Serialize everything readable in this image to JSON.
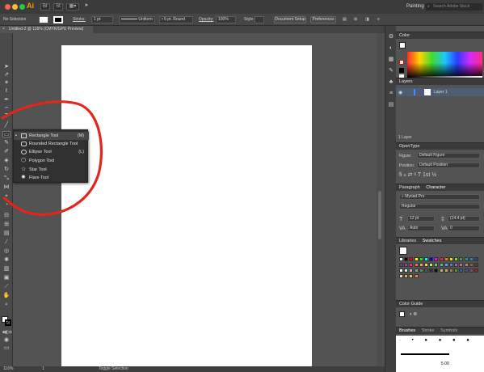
{
  "menubar": {
    "workspace": "Painting",
    "search_placeholder": "Search Adobe Stock",
    "traffic_colors": [
      "#fe5f57",
      "#febb2e",
      "#28c840"
    ],
    "app_icon": "Ai"
  },
  "controlbar": {
    "selection": "No Selection",
    "stroke_label": "Stroke:",
    "stroke_weight": "1 pt",
    "profile": "Uniform",
    "brush": "5 pt. Round",
    "opacity_label": "Opacity:",
    "opacity_value": "100%",
    "style_label": "Style:",
    "document_setup": "Document Setup",
    "preferences": "Preferences"
  },
  "document": {
    "tab_title": "Untitled-2 @ 116% (CMYK/GPU Preview)"
  },
  "flyout": {
    "items": [
      {
        "label": "Rectangle Tool",
        "key": "(M)"
      },
      {
        "label": "Rounded Rectangle Tool",
        "key": ""
      },
      {
        "label": "Ellipse Tool",
        "key": "(L)"
      },
      {
        "label": "Polygon Tool",
        "key": ""
      },
      {
        "label": "Star Tool",
        "key": ""
      },
      {
        "label": "Flare Tool",
        "key": ""
      }
    ]
  },
  "statusbar": {
    "zoom": "116%",
    "page": "1",
    "mode": "Toggle Selection"
  },
  "panels": {
    "color_title": "Color",
    "layers_title": "Layers",
    "layer_name": "Layer 1",
    "layers_count": "1 Layer",
    "opentype_title": "OpenType",
    "figure_label": "Figure:",
    "figure_value": "Default Figure",
    "position_label": "Position:",
    "position_value": "Default Position",
    "paragraph_tab": "Paragraph",
    "character_tab": "Character",
    "font_family": "Myriad Pro",
    "font_style": "Regular",
    "font_size": "12 pt",
    "leading": "(14.4 pt)",
    "tracking_auto": "Auto",
    "tracking_zero": "0",
    "libraries_tab": "Libraries",
    "swatches_tab": "Swatches",
    "color_guide_title": "Color Guide",
    "brushes_tab": "Brushes",
    "stroke_tab": "Stroke",
    "symbols_tab": "Symbols",
    "brush_size_label": "5.00"
  },
  "swatch_colors": [
    "#ffffff",
    "#000000",
    "#ff0000",
    "#ffff00",
    "#00ff00",
    "#00ffff",
    "#0000ff",
    "#ff00ff",
    "#e4282e",
    "#ef7d22",
    "#f6e500",
    "#9cc93b",
    "#2aa64a",
    "#1a9d8d",
    "#1c8ed0",
    "#274594",
    "#5e3b95",
    "#a23d92",
    "#e0307b",
    "#ec6d5d",
    "#f4a261",
    "#f6d35d",
    "#cbe07f",
    "#7cc07a",
    "#57b8a8",
    "#5fa6dc",
    "#6678b8",
    "#8d6bb0",
    "#c26bab",
    "#b38a6b",
    "#8a6545",
    "#5b3e2b",
    "#ffffff",
    "#dddddd",
    "#bbbbbb",
    "#999999",
    "#777777",
    "#555555",
    "#333333",
    "#111111",
    "#c2b280",
    "#d1a95a",
    "#a97c50",
    "#6b8e23",
    "#2f5f8a",
    "#4a4a8a",
    "#7a4a7a",
    "#8a2a2a",
    "#e8d6b0",
    "#c9b27a",
    "#f2c14e",
    "#f78154"
  ],
  "toolbar_icons": [
    "selection-icon",
    "direct-selection-icon",
    "magic-wand-icon",
    "lasso-icon",
    "pen-icon",
    "curvature-icon",
    "type-icon",
    "line-icon",
    "rectangle-icon",
    "paintbrush-icon",
    "shaper-icon",
    "eraser-icon",
    "rotate-icon",
    "scale-icon",
    "width-icon",
    "free-transform-icon",
    "shape-builder-icon",
    "perspective-icon",
    "mesh-icon",
    "gradient-icon",
    "eyedropper-icon",
    "blend-icon",
    "symbol-sprayer-icon",
    "column-graph-icon",
    "artboard-icon",
    "slice-icon",
    "hand-icon",
    "zoom-icon"
  ]
}
